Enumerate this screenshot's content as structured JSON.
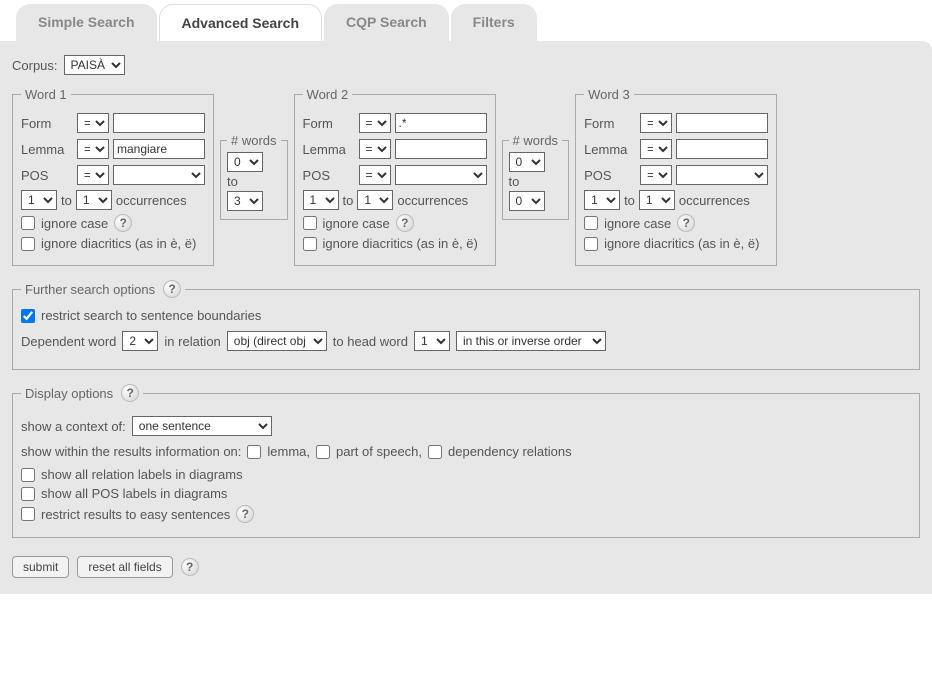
{
  "tabs": {
    "simple": "Simple Search",
    "advanced": "Advanced Search",
    "cqp": "CQP Search",
    "filters": "Filters"
  },
  "corpus": {
    "label": "Corpus:",
    "value": "PAISÀ"
  },
  "labels": {
    "form": "Form",
    "lemma": "Lemma",
    "pos": "POS",
    "to": "to",
    "occurrences": "occurrences",
    "ignore_case": "ignore case",
    "ignore_diacritics": "ignore diacritics (as in è, ë)",
    "nwords": "# words",
    "eq": "="
  },
  "word1": {
    "legend": "Word 1",
    "form_op": "=",
    "form_val": "",
    "lemma_op": "=",
    "lemma_val": "mangiare",
    "pos_op": "=",
    "pos_val": "",
    "occ_from": "1",
    "occ_to": "1"
  },
  "nwords1": {
    "from": "0",
    "to": "3"
  },
  "word2": {
    "legend": "Word 2",
    "form_op": "=",
    "form_val": ".*",
    "lemma_op": "=",
    "lemma_val": "",
    "pos_op": "=",
    "pos_val": "",
    "occ_from": "1",
    "occ_to": "1"
  },
  "nwords2": {
    "from": "0",
    "to": "0"
  },
  "word3": {
    "legend": "Word 3",
    "form_op": "=",
    "form_val": "",
    "lemma_op": "=",
    "lemma_val": "",
    "pos_op": "=",
    "pos_val": "",
    "occ_from": "1",
    "occ_to": "1"
  },
  "further": {
    "legend": "Further search options",
    "restrict": "restrict search to sentence boundaries",
    "dep_label": "Dependent word",
    "dep_word": "2",
    "in_relation": "in relation",
    "relation": "obj (direct obj",
    "to_head": "to head word",
    "head_word": "1",
    "order": "in this or inverse order"
  },
  "display": {
    "legend": "Display options",
    "context_label": "show a context of:",
    "context_value": "one sentence",
    "info_label": "show within the results information on:",
    "lemma": "lemma,",
    "pos": "part of speech,",
    "dep": "dependency relations",
    "all_rel": "show all relation labels in diagrams",
    "all_pos": "show all POS labels in diagrams",
    "easy": "restrict results to easy sentences"
  },
  "buttons": {
    "submit": "submit",
    "reset": "reset all fields"
  },
  "help": "?"
}
